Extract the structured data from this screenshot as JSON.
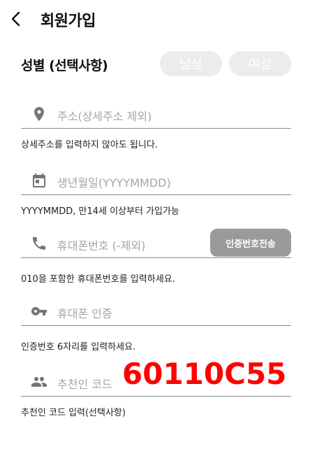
{
  "header": {
    "title": "회원가입",
    "back_icon": "chevron-left-icon"
  },
  "gender": {
    "label": "성별 (선택사항)",
    "male_label": "남성",
    "female_label": "여성"
  },
  "fields": {
    "address": {
      "icon": "location-pin-icon",
      "placeholder": "주소(상세주소 제외)",
      "hint": "상세주소를 입력하지 않아도 됩니다."
    },
    "birth": {
      "icon": "calendar-icon",
      "placeholder": "생년월일(YYYYMMDD)",
      "hint": "YYYYMMDD, 만14세 이상부터 가입가능"
    },
    "phone": {
      "icon": "phone-icon",
      "placeholder": "휴대폰번호 (-제외)",
      "hint": "010을 포함한 휴대폰번호를 입력하세요.",
      "send_button": "인증번호전송"
    },
    "verify": {
      "icon": "key-icon",
      "placeholder": "휴대폰 인증",
      "hint": "인증번호 6자리를 입력하세요."
    },
    "referral": {
      "icon": "people-icon",
      "placeholder": "추천인 코드",
      "hint": "추천인 코드 입력(선택사항)",
      "code": "60110C55"
    }
  },
  "colors": {
    "accent_code": "#ff0000",
    "button_gray": "#9a9a9a",
    "toggle_bg": "#ececec",
    "placeholder": "#a5a5a5"
  }
}
